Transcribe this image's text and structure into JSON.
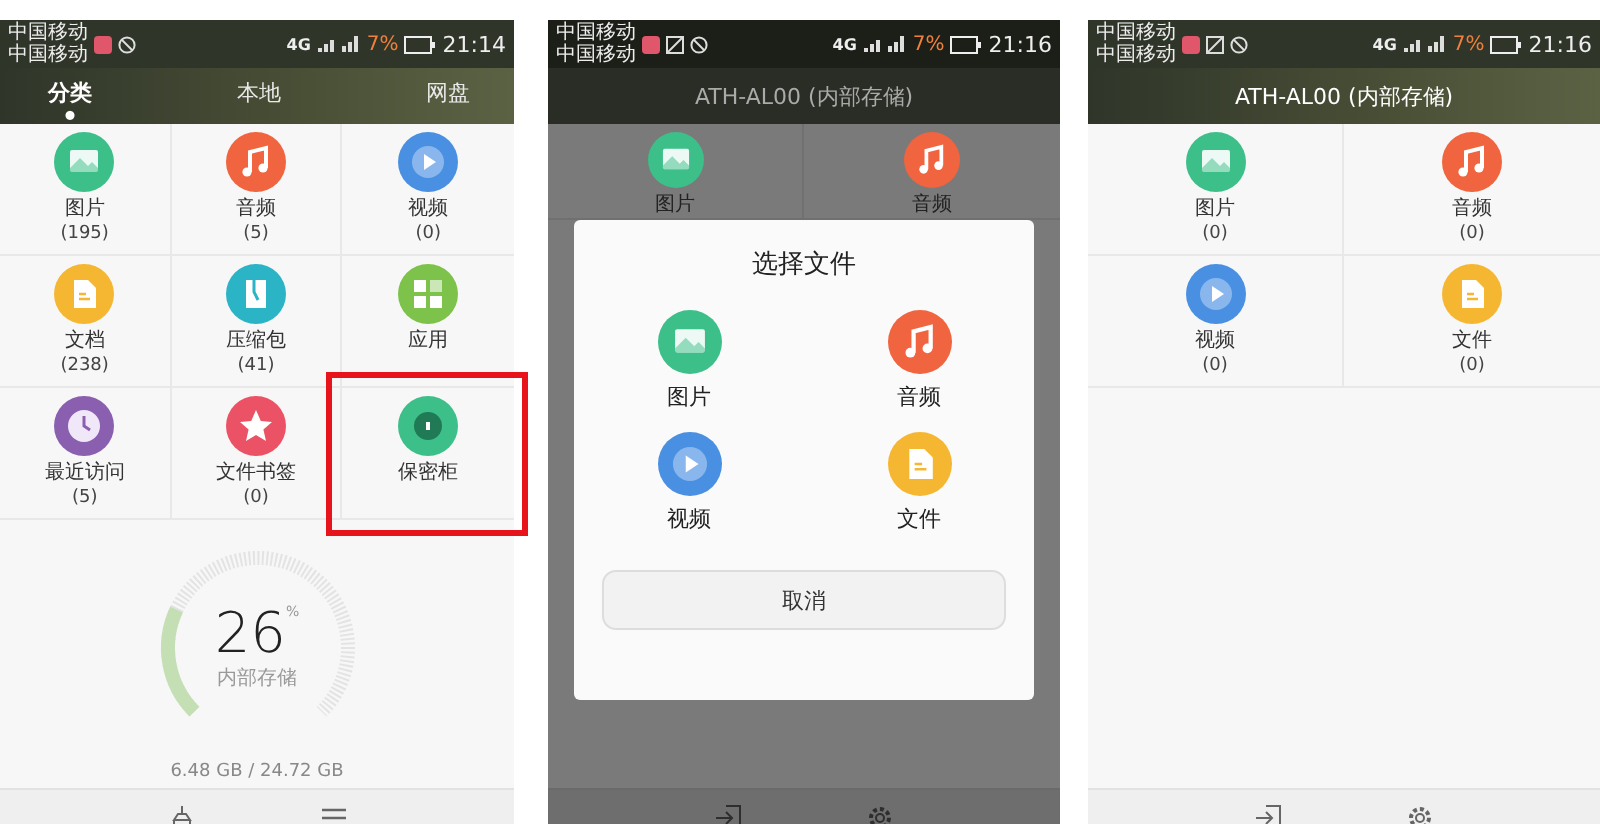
{
  "left_screen": {
    "status": {
      "carriers": [
        "中国移动",
        "中国移动"
      ],
      "network": "4G",
      "battery": "7%",
      "time": "21:14"
    },
    "tabs": [
      {
        "label": "分类",
        "selected": true
      },
      {
        "label": "本地",
        "selected": false
      },
      {
        "label": "网盘",
        "selected": false
      }
    ],
    "grid": [
      {
        "kind": "picture",
        "label": "图片",
        "count": "(195)",
        "color": "#3dbf8a",
        "highlighted": false
      },
      {
        "kind": "music",
        "label": "音频",
        "count": "(5)",
        "color": "#f0643f",
        "highlighted": false
      },
      {
        "kind": "video",
        "label": "视频",
        "count": "(0)",
        "color": "#4a90e2",
        "highlighted": false
      },
      {
        "kind": "document",
        "label": "文档",
        "count": "(238)",
        "color": "#f5b731",
        "highlighted": false
      },
      {
        "kind": "zip",
        "label": "压缩包",
        "count": "(41)",
        "color": "#2bb3c6",
        "highlighted": false
      },
      {
        "kind": "apps",
        "label": "应用",
        "color": "#7dc24b",
        "highlighted": false
      },
      {
        "kind": "clock",
        "label": "最近访问",
        "count": "(5)",
        "color": "#8a5fb0",
        "highlighted": false
      },
      {
        "kind": "star",
        "label": "文件书签",
        "count": "(0)",
        "color": "#ec5266",
        "highlighted": false
      },
      {
        "kind": "lock",
        "label": "保密柜",
        "color": "#3dbf8a",
        "highlighted": true
      }
    ],
    "storage": {
      "percent": "26",
      "unit": "%",
      "label": "内部存储",
      "usage": "6.48 GB / 24.72 GB"
    }
  },
  "middle_screen": {
    "status": {
      "carriers": [
        "中国移动",
        "中国移动"
      ],
      "network": "4G",
      "battery": "7%",
      "time": "21:16"
    },
    "title": "ATH-AL00 (内部存储)",
    "background_items": [
      {
        "kind": "picture",
        "label": "图片",
        "color": "#3dbf8a"
      },
      {
        "kind": "music",
        "label": "音频",
        "color": "#f0643f"
      }
    ],
    "dialog": {
      "title": "选择文件",
      "options": [
        {
          "kind": "picture",
          "label": "图片",
          "color": "#3dbf8a"
        },
        {
          "kind": "music",
          "label": "音频",
          "color": "#f0643f"
        },
        {
          "kind": "video",
          "label": "视频",
          "color": "#4a90e2"
        },
        {
          "kind": "document",
          "label": "文件",
          "color": "#f5b731"
        }
      ],
      "cancel": "取消"
    }
  },
  "right_screen": {
    "status": {
      "carriers": [
        "中国移动",
        "中国移动"
      ],
      "network": "4G",
      "battery": "7%",
      "time": "21:16"
    },
    "title": "ATH-AL00 (内部存储)",
    "grid": [
      {
        "kind": "picture",
        "label": "图片",
        "count": "(0)",
        "color": "#3dbf8a"
      },
      {
        "kind": "music",
        "label": "音频",
        "count": "(0)",
        "color": "#f0643f"
      },
      {
        "kind": "video",
        "label": "视频",
        "count": "(0)",
        "color": "#4a90e2"
      },
      {
        "kind": "document",
        "label": "文件",
        "count": "(0)",
        "color": "#f5b731"
      }
    ]
  }
}
